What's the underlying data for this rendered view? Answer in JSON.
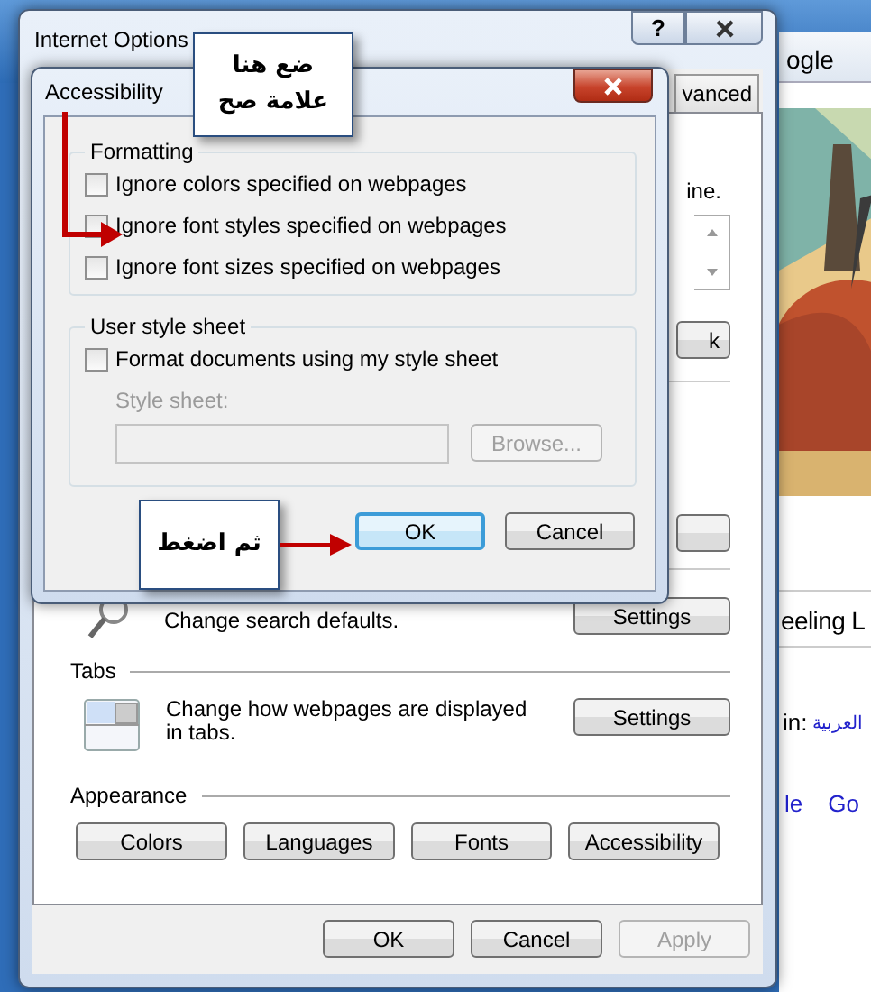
{
  "browser": {
    "tab_fragment": "ogle",
    "headline_fragment": "eeling L",
    "language_label": "in:",
    "language_link": "العربية",
    "link_fragments": [
      "le",
      "Go"
    ]
  },
  "internet_options": {
    "title": "Internet Options",
    "help_button": "?",
    "tabs": [
      {
        "label": "vanced",
        "selected": false
      }
    ],
    "hidden_text_fragment": "ine.",
    "hidden_button_fragment": "k",
    "search": {
      "text": "Change search defaults.",
      "button": "Settings"
    },
    "tabs_section": {
      "heading": "Tabs",
      "text": "Change how webpages are displayed in tabs.",
      "button": "Settings"
    },
    "appearance": {
      "heading": "Appearance",
      "buttons": [
        "Colors",
        "Languages",
        "Fonts",
        "Accessibility"
      ]
    },
    "buttons": [
      {
        "label": "OK",
        "disabled": false
      },
      {
        "label": "Cancel",
        "disabled": false
      },
      {
        "label": "Apply",
        "disabled": true
      }
    ]
  },
  "accessibility_dialog": {
    "title": "Accessibility",
    "formatting": {
      "heading": "Formatting",
      "options": [
        {
          "label": "Ignore colors specified on webpages",
          "checked": false
        },
        {
          "label": "Ignore font styles specified on webpages",
          "checked": false
        },
        {
          "label": "Ignore font sizes specified on webpages",
          "checked": false
        }
      ]
    },
    "user_style_sheet": {
      "heading": "User style sheet",
      "option": {
        "label": "Format documents using my style sheet",
        "checked": false
      },
      "field_label": "Style sheet:",
      "field_disabled": true,
      "browse_button": "Browse...",
      "browse_disabled": true
    },
    "buttons": [
      {
        "label": "OK",
        "focused": true
      },
      {
        "label": "Cancel",
        "focused": false
      }
    ]
  },
  "annotations": [
    {
      "text": "ضع هنا علامة صح"
    },
    {
      "text": "ثم اضغط"
    }
  ]
}
